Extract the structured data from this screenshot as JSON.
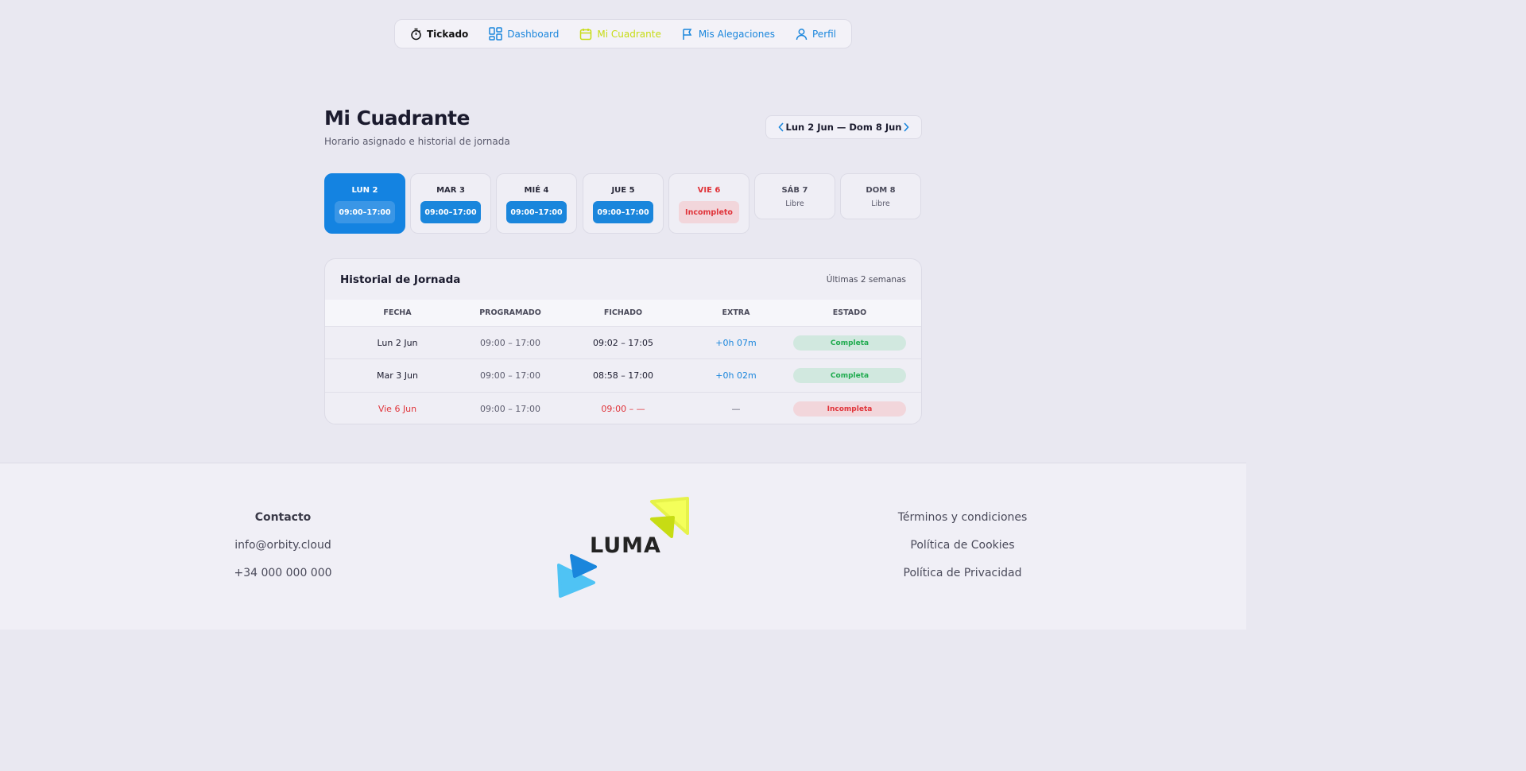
{
  "nav": {
    "brand": "Tickado",
    "items": [
      "Dashboard",
      "Mi Cuadrante",
      "Mis Alegaciones",
      "Perfil"
    ]
  },
  "header": {
    "title": "Mi Cuadrante",
    "subtitle": "Horario asignado e historial de jornada",
    "week_range": "Lun 2 Jun — Dom 8 Jun"
  },
  "days": [
    {
      "label": "LUN 2",
      "value": "09:00–17:00"
    },
    {
      "label": "MAR 3",
      "value": "09:00–17:00"
    },
    {
      "label": "MIÉ 4",
      "value": "09:00–17:00"
    },
    {
      "label": "JUE 5",
      "value": "09:00–17:00"
    },
    {
      "label": "VIE 6",
      "value": "Incompleto"
    },
    {
      "label": "SÁB 7",
      "value": "Libre"
    },
    {
      "label": "DOM 8",
      "value": "Libre"
    }
  ],
  "history": {
    "title": "Historial de Jornada",
    "range": "Últimas 2 semanas",
    "columns": [
      "FECHA",
      "PROGRAMADO",
      "FICHADO",
      "EXTRA",
      "ESTADO"
    ],
    "rows": [
      [
        "Lun 2 Jun",
        "09:00 – 17:00",
        "09:02 – 17:05",
        "+0h 07m",
        "Completa"
      ],
      [
        "Mar 3 Jun",
        "09:00 – 17:00",
        "08:58 – 17:00",
        "+0h 02m",
        "Completa"
      ],
      [
        "Vie 6 Jun",
        "09:00 – 17:00",
        "09:00 – —",
        "—",
        "Incompleta"
      ]
    ]
  },
  "footer": {
    "contact_title": "Contacto",
    "email": "info@orbity.cloud",
    "phone": "+34 000 000 000",
    "logo_text": "LUMA",
    "links": [
      "Términos y condiciones",
      "Política de Cookies",
      "Política de Privacidad"
    ]
  },
  "colors": {
    "accent_blue": "#1a86dc",
    "active_nav": "#c7dc14",
    "error_red": "#e0343a",
    "success_green": "#1fab4e"
  }
}
